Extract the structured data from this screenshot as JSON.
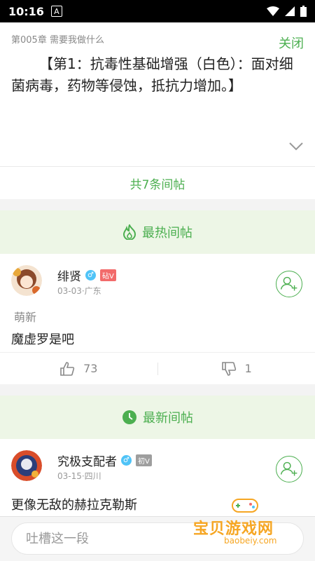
{
  "status_bar": {
    "time": "10:16",
    "badge": "A"
  },
  "chapter": {
    "title": "第005章 需要我做什么",
    "close_label": "关闭",
    "content": "【第1：抗毒性基础增强（白色）：面对细菌病毒，药物等侵蚀，抵抗力增加。】"
  },
  "total_replies": "共7条间帖",
  "hot_section": {
    "label": "最热间帖"
  },
  "new_section": {
    "label": "最新间帖"
  },
  "hot_comment": {
    "username": "绯贤",
    "gender": "♂",
    "level": "砧V",
    "meta": "03-03·广东",
    "tag": "萌新",
    "text": "魔虚罗是吧",
    "likes": "73",
    "dislikes": "1"
  },
  "new_comment": {
    "username": "究极支配者",
    "gender": "♂",
    "level": "初V",
    "meta": "03-15·四川",
    "text": "更像无敌的赫拉克勒斯"
  },
  "input": {
    "placeholder": "吐槽这一段"
  },
  "watermark": {
    "title": "宝贝游戏网",
    "url": "baobeiy.com"
  },
  "colors": {
    "accent": "#4caf50",
    "section_bg": "#edf6e6",
    "level_hot": "#f26b6b",
    "level_new": "#9e9e9e"
  }
}
